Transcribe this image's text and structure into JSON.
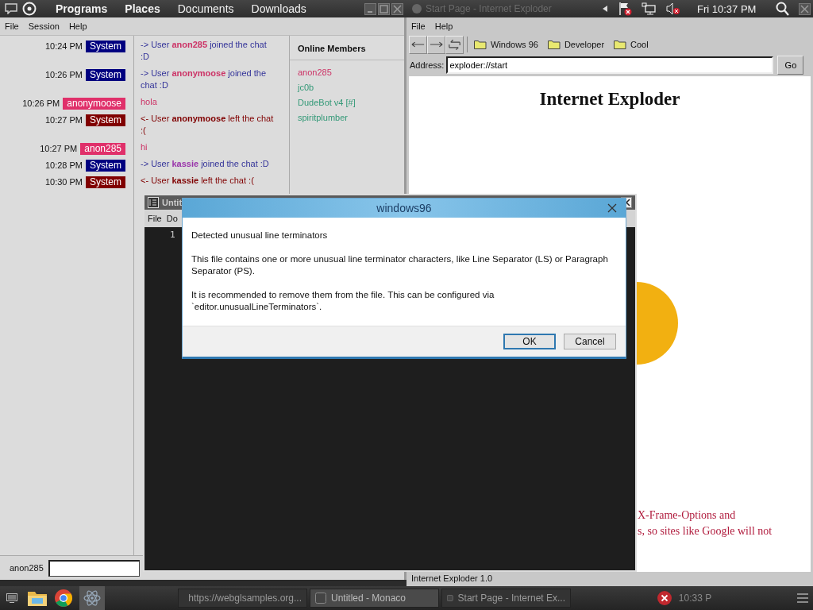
{
  "top_panel": {
    "menus": [
      {
        "label": "Programs",
        "bold": true
      },
      {
        "label": "Places",
        "bold": true
      },
      {
        "label": "Documents",
        "bold": false
      },
      {
        "label": "Downloads",
        "bold": false
      }
    ],
    "background_title": "Start Page - Internet Exploder",
    "clock": "Fri 10:37 PM"
  },
  "chat_window": {
    "menu": [
      "File",
      "Session",
      "Help"
    ],
    "messages": [
      {
        "kind": "join",
        "time": "10:24 PM",
        "sender": "System",
        "before": "-> User",
        "user": {
          "name": "anon285",
          "color": "#cc3366"
        },
        "after": "joined the chat :D"
      },
      {
        "kind": "join",
        "time": "10:26 PM",
        "sender": "System",
        "before": "-> User",
        "user": {
          "name": "anonymoose",
          "color": "#cc3366"
        },
        "after": "joined the chat :D"
      },
      {
        "kind": "chat",
        "time": "10:26 PM",
        "sender": "anonymoose",
        "text": "hola"
      },
      {
        "kind": "leave",
        "time": "10:27 PM",
        "sender": "System",
        "before": "<- User",
        "user": {
          "name": "anonymoose"
        },
        "after": "left the chat :("
      },
      {
        "kind": "chat",
        "time": "10:27 PM",
        "sender": "anon285",
        "text": "hi"
      },
      {
        "kind": "join",
        "time": "10:28 PM",
        "sender": "System",
        "before": "-> User",
        "user": {
          "name": "kassie",
          "color": "#9933aa"
        },
        "after": "joined the chat :D"
      },
      {
        "kind": "leave",
        "time": "10:30 PM",
        "sender": "System",
        "before": "<- User",
        "user": {
          "name": "kassie"
        },
        "after": "left the chat :("
      }
    ],
    "members_title": "Online Members",
    "members": [
      {
        "name": "anon285",
        "color": "#cc3366"
      },
      {
        "name": "jc0b",
        "color": "#339977"
      },
      {
        "name": "DudeBot v4 [#]",
        "color": "#339977"
      },
      {
        "name": "spiritplumber",
        "color": "#339977"
      }
    ],
    "input_label": "anon285"
  },
  "browser_window": {
    "menu": [
      "File",
      "Help"
    ],
    "bookmarks": [
      "Windows 96",
      "Developer",
      "Cool"
    ],
    "address_label": "Address:",
    "address": "exploder://start",
    "go": "Go",
    "heading": "Internet Exploder",
    "notice_lines": [
      "X-Frame-Options and",
      "s, so sites like Google will not"
    ],
    "status": "Internet Exploder 1.0"
  },
  "editor_window": {
    "title": "Untit",
    "menu": [
      "File",
      "Do"
    ],
    "line_number": "1"
  },
  "dialog": {
    "title": "windows96",
    "heading": "Detected unusual line terminators",
    "paragraphs": [
      "This file contains one or more unusual line terminator characters, like Line Separator (LS) or Paragraph Separator (PS).",
      "It is recommended to remove them from the file. This can be configured via `editor.unusualLineTerminators`."
    ],
    "buttons": [
      {
        "label": "OK",
        "selected": true
      },
      {
        "label": "Cancel",
        "selected": false
      }
    ]
  },
  "taskbar": {
    "tasks": [
      {
        "label": "https://webglsamples.org...",
        "selected": false
      },
      {
        "label": "Untitled - Monaco",
        "selected": true
      },
      {
        "label": "Start Page - Internet Ex...",
        "selected": false
      }
    ],
    "clock": "10:33 P"
  }
}
